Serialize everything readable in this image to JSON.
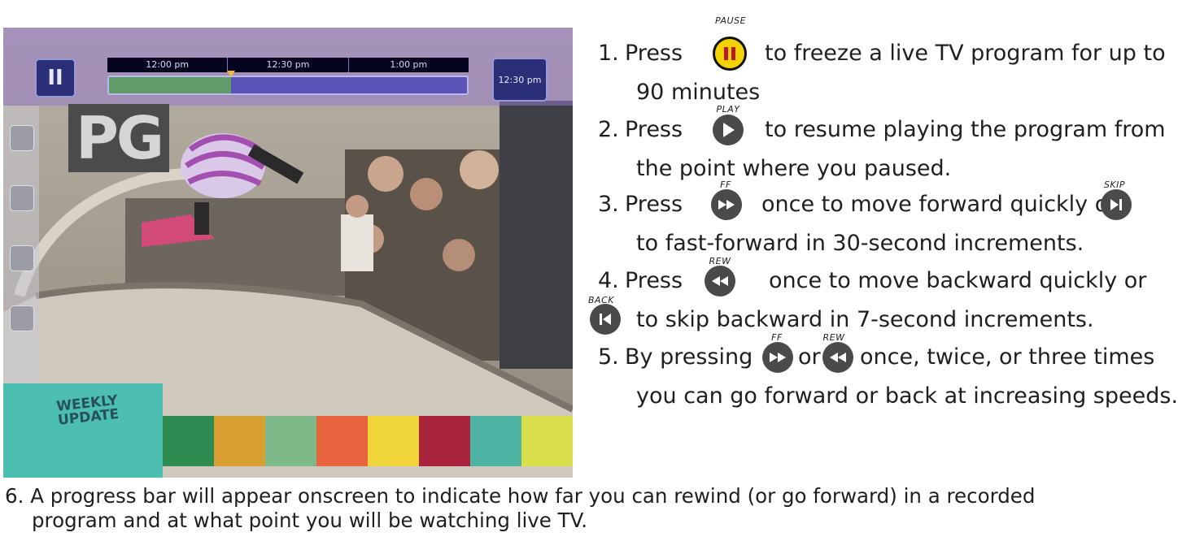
{
  "tv_screen": {
    "pause_symbol": "II",
    "timeline": {
      "times": [
        "12:00 pm",
        "12:30 pm",
        "1:00 pm"
      ],
      "progress_fraction": 0.34
    },
    "current_time": "12:30 pm",
    "rating": "PG",
    "promo_text": "WEEKLY UPDATE",
    "strip_colors": [
      "#2e8b52",
      "#d8a032",
      "#7eb98a",
      "#e7643e",
      "#f0d53a",
      "#a7243c",
      "#4fb3a3",
      "#d9df4a"
    ]
  },
  "instructions": {
    "step1": {
      "number": "1.",
      "pre": "Press",
      "button_caption": "PAUSE",
      "post": "to freeze a live TV program for up to",
      "cont": "90 minutes"
    },
    "step2": {
      "number": "2.",
      "pre": "Press",
      "button_caption": "PLAY",
      "post": "to resume playing the program from",
      "cont": "the point where you paused."
    },
    "step3": {
      "number": "3.",
      "pre": "Press",
      "button_caption": "FF",
      "mid": "once to move forward quickly or",
      "button2_caption": "SKIP",
      "cont": "to fast-forward in 30-second increments."
    },
    "step4": {
      "number": "4.",
      "pre": "Press",
      "button_caption": "REW",
      "mid": "once to move backward quickly or",
      "button2_caption": "BACK",
      "cont": "to skip backward in 7-second increments."
    },
    "step5": {
      "number": "5.",
      "pre": "By pressing",
      "button_caption": "FF",
      "or": "or",
      "button2_caption": "REW",
      "post": "once, twice, or three times",
      "cont": "you can go forward or back at increasing speeds."
    },
    "step6": {
      "number": "6.",
      "line1": "A progress bar will appear onscreen to indicate how far you can rewind (or go forward) in a recorded",
      "line2": "program and at what point you will be watching live TV."
    }
  }
}
